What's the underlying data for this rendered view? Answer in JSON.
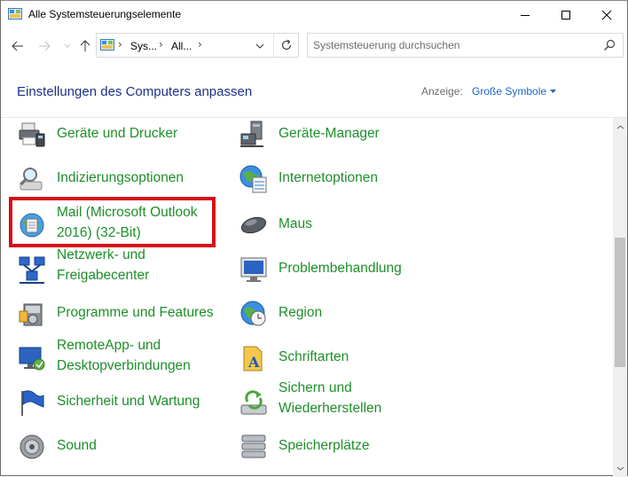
{
  "window": {
    "title": "Alle Systemsteuerungselemente",
    "minimize_icon": "minimize-icon",
    "maximize_icon": "maximize-icon",
    "close_icon": "close-icon"
  },
  "address": {
    "crumbs": [
      "Sys...",
      "All..."
    ],
    "search_placeholder": "Systemsteuerung durchsuchen"
  },
  "header": {
    "title": "Einstellungen des Computers anpassen",
    "view_label": "Anzeige:",
    "view_value": "Große Symbole"
  },
  "colors": {
    "link_green": "#1e8e2a",
    "heading_blue": "#1e3287",
    "accent_blue": "#1a66c7",
    "highlight_red": "#d60d16"
  },
  "items": {
    "devices_printers": {
      "line1": "Geräte und Drucker",
      "line2": "",
      "icon": "printer-icon"
    },
    "device_manager": {
      "line1": "Geräte-Manager",
      "line2": "",
      "icon": "device-manager-icon"
    },
    "indexing": {
      "line1": "Indizierungsoptionen",
      "line2": "",
      "icon": "indexing-icon"
    },
    "internet_options": {
      "line1": "Internetoptionen",
      "line2": "",
      "icon": "internet-options-icon"
    },
    "mail": {
      "line1": "Mail (Microsoft Outlook",
      "line2": "2016) (32-Bit)",
      "icon": "mail-icon"
    },
    "mouse": {
      "line1": "Maus",
      "line2": "",
      "icon": "mouse-icon"
    },
    "network": {
      "line1": "Netzwerk- und",
      "line2": "Freigabecenter",
      "icon": "network-icon"
    },
    "troubleshooting": {
      "line1": "Problembehandlung",
      "line2": "",
      "icon": "troubleshooting-icon"
    },
    "programs": {
      "line1": "Programme und Features",
      "line2": "",
      "icon": "programs-icon"
    },
    "region": {
      "line1": "Region",
      "line2": "",
      "icon": "region-icon"
    },
    "remoteapp": {
      "line1": "RemoteApp- und",
      "line2": "Desktopverbindungen",
      "icon": "remoteapp-icon"
    },
    "fonts": {
      "line1": "Schriftarten",
      "line2": "",
      "icon": "fonts-icon"
    },
    "security": {
      "line1": "Sicherheit und Wartung",
      "line2": "",
      "icon": "flag-icon"
    },
    "backup": {
      "line1": "Sichern und",
      "line2": "Wiederherstellen",
      "icon": "backup-icon"
    },
    "sound": {
      "line1": "Sound",
      "line2": "",
      "icon": "speaker-icon"
    },
    "storage": {
      "line1": "Speicherplätze",
      "line2": "",
      "icon": "storage-icon"
    }
  }
}
